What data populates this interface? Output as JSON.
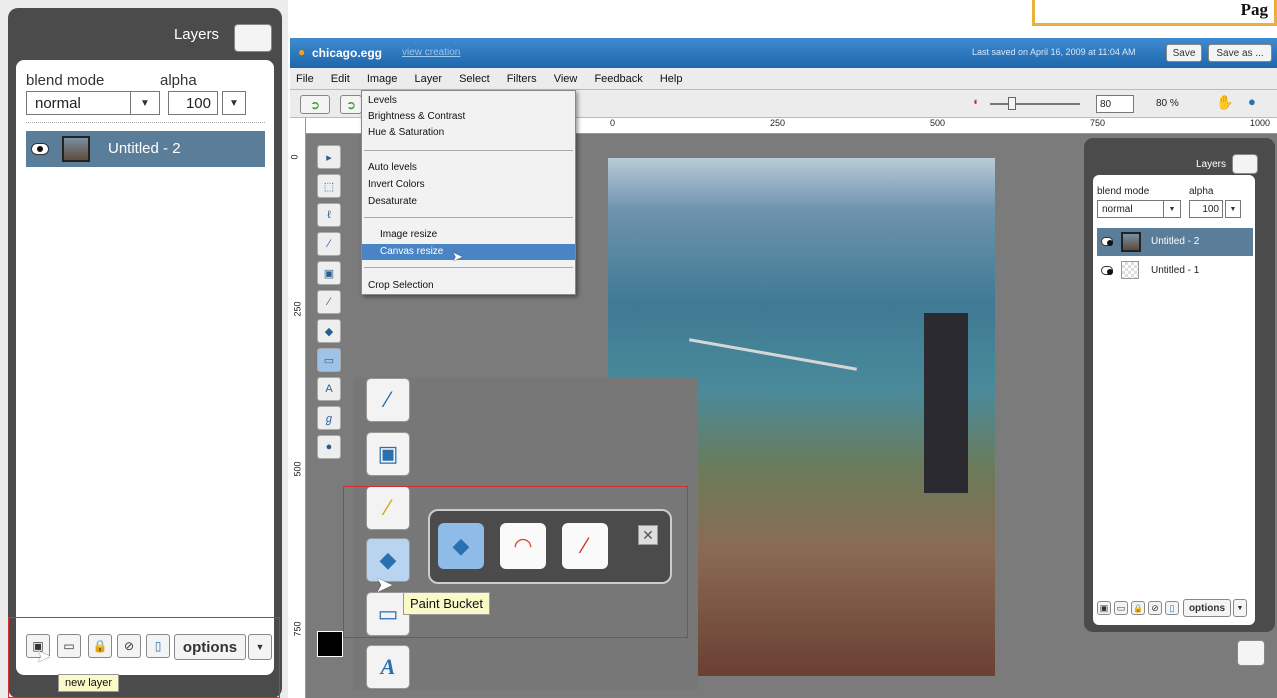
{
  "page_label": "Pag",
  "left_panel": {
    "title": "Layers",
    "blend_mode_label": "blend mode",
    "alpha_label": "alpha",
    "blend_mode_value": "normal",
    "alpha_value": "100",
    "layer_name": "Untitled - 2",
    "options_label": "options",
    "tooltip": "new layer"
  },
  "app": {
    "file_name": "chicago.egg",
    "view_link": "view creation",
    "last_saved": "Last saved on April 16, 2009 at 11:04 AM",
    "save_label": "Save",
    "save_as_label": "Save as ...",
    "menus": [
      "File",
      "Edit",
      "Image",
      "Layer",
      "Select",
      "Filters",
      "View",
      "Feedback",
      "Help"
    ],
    "zoom_input": "80",
    "zoom_percent": "80 %",
    "ruler_h": [
      "0",
      "250",
      "500",
      "750",
      "1000"
    ],
    "ruler_v": [
      "0",
      "250",
      "500",
      "750"
    ]
  },
  "image_menu": {
    "items": [
      "Levels",
      "Brightness & Contrast",
      "Hue & Saturation",
      "Auto levels",
      "Invert Colors",
      "Desaturate",
      "Image resize",
      "Canvas resize",
      "Crop Selection"
    ]
  },
  "zoom_overlay": {
    "tooltip": "Paint Bucket"
  },
  "right_panel": {
    "title": "Layers",
    "blend_mode_label": "blend mode",
    "alpha_label": "alpha",
    "blend_mode_value": "normal",
    "alpha_value": "100",
    "layers": [
      "Untitled - 2",
      "Untitled - 1"
    ],
    "options_label": "options"
  },
  "colors": {
    "titlebar": "#2a73b8",
    "layer_selected": "#5a7d9a",
    "red_highlight": "#d03030"
  }
}
